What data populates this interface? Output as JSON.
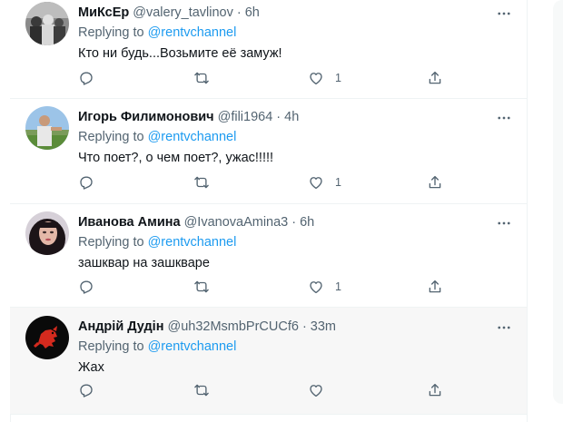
{
  "tweets": [
    {
      "name": "МиКсЕр",
      "handle": "@valery_tavlinov",
      "time": "6h",
      "reply_prefix": "Replying to",
      "reply_mention": "@rentvchannel",
      "text": "Кто ни будь...Возьмите её замуж!",
      "likes": "1",
      "avatar_desc": "grayscale group photo"
    },
    {
      "name": "Игорь Филимонович",
      "handle": "@fili1964",
      "time": "4h",
      "reply_prefix": "Replying to",
      "reply_mention": "@rentvchannel",
      "text": "Что поет?, о чем поет?, ужас!!!!!",
      "likes": "1",
      "avatar_desc": "man outdoors"
    },
    {
      "name": "Иванова Амина",
      "handle": "@IvanovaAmina3",
      "time": "6h",
      "reply_prefix": "Replying to",
      "reply_mention": "@rentvchannel",
      "text": "зашквар на зашкваре",
      "likes": "1",
      "avatar_desc": "woman with dark hair"
    },
    {
      "name": "Андрій Дудін",
      "handle": "@uh32MsmbPrCUCf6",
      "time": "33m",
      "reply_prefix": "Replying to",
      "reply_mention": "@rentvchannel",
      "text": "Жах",
      "likes": "",
      "avatar_desc": "red lion emblem on black"
    }
  ],
  "icons": {
    "reply": "reply-icon",
    "retweet": "retweet-icon",
    "like": "heart-icon",
    "share": "share-icon",
    "more": "more-icon"
  },
  "colors": {
    "link": "#1d9bf0",
    "secondary_text": "#536471",
    "primary_text": "#0f1419",
    "hover_bg": "#f7f7f7"
  }
}
